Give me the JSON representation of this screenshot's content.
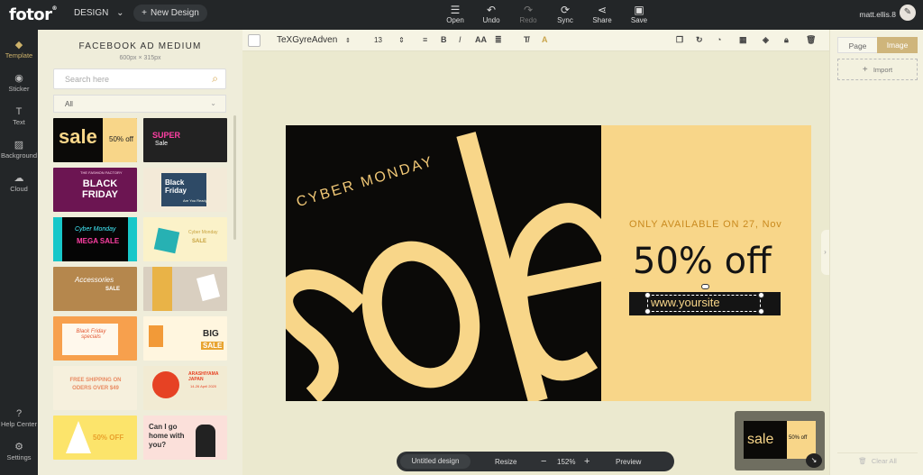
{
  "topbar": {
    "logo": "fotor",
    "design_label": "DESIGN",
    "new_design_label": "New Design",
    "actions": [
      {
        "label": "Open",
        "icon": "menu-icon"
      },
      {
        "label": "Undo",
        "icon": "undo-icon"
      },
      {
        "label": "Redo",
        "icon": "redo-icon"
      },
      {
        "label": "Sync",
        "icon": "sync-icon"
      },
      {
        "label": "Share",
        "icon": "share-icon"
      },
      {
        "label": "Save",
        "icon": "save-icon"
      }
    ],
    "user": "matt.ellis.8"
  },
  "rail": {
    "items": [
      {
        "label": "Template",
        "icon": "template-icon"
      },
      {
        "label": "Sticker",
        "icon": "sticker-icon"
      },
      {
        "label": "Text",
        "icon": "text-icon"
      },
      {
        "label": "Background",
        "icon": "background-icon"
      },
      {
        "label": "Cloud",
        "icon": "cloud-icon"
      },
      {
        "label": "Help Center",
        "icon": "help-icon"
      },
      {
        "label": "Settings",
        "icon": "settings-icon"
      }
    ]
  },
  "panel": {
    "title": "FACEBOOK AD MEDIUM",
    "subtitle": "600px × 315px",
    "search_placeholder": "Search here",
    "filter_value": "All",
    "templates": [
      {
        "text": "sale",
        "sub": "50% off"
      },
      {
        "text": "SUPER",
        "sub": "Sale"
      },
      {
        "text": "BLACK FRIDAY",
        "sub": "THE FASHION FACTORY"
      },
      {
        "text": "Black Friday",
        "sub": "Are You Ready"
      },
      {
        "text": "Cyber Monday",
        "sub": "MEGA SALE"
      },
      {
        "text": "Cyber Monday",
        "sub": "SALE"
      },
      {
        "text": "Accessories",
        "sub": "SALE"
      },
      {
        "text": "",
        "sub": ""
      },
      {
        "text": "Black Friday specials",
        "sub": ""
      },
      {
        "text": "BIG",
        "sub": "SALE"
      },
      {
        "text": "FREE SHIPPING ON ODERS OVER $49",
        "sub": ""
      },
      {
        "text": "ARASHIYAMA JAPAN",
        "sub": "14-26 April 2020"
      },
      {
        "text": "50% OFF",
        "sub": ""
      },
      {
        "text": "Can I go home with you?",
        "sub": ""
      }
    ]
  },
  "toolbar": {
    "font": "TeXGyreAdven",
    "size": "13"
  },
  "ad": {
    "cyber": "CYBER MONDAY",
    "sale": "sale",
    "available": "ONLY AVAILABLE ON 27, Nov",
    "offer": "50% off",
    "url": "www.yoursite"
  },
  "bottombar": {
    "name": "Untitled design",
    "resize": "Resize",
    "zoom": "152%",
    "preview": "Preview"
  },
  "right": {
    "tab_page": "Page",
    "tab_image": "Image",
    "import": "Import",
    "clear": "Clear All"
  },
  "colors": {
    "accent": "#ccb16a",
    "ad_yellow": "#f8d689",
    "ad_black": "#0b0a08"
  }
}
